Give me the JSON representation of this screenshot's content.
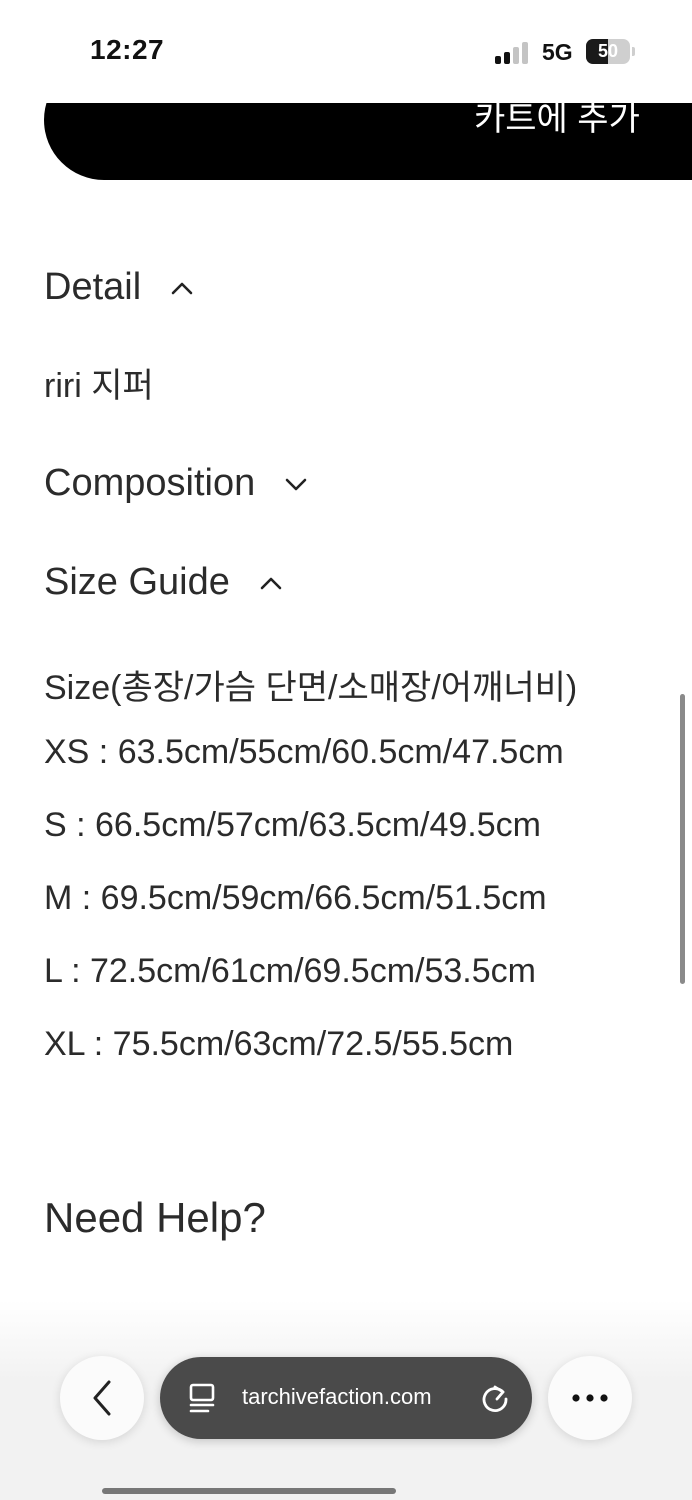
{
  "status_bar": {
    "time": "12:27",
    "network": "5G",
    "battery": "50",
    "battery_level": 0.5
  },
  "cart": {
    "label": "카트에 추가"
  },
  "sections": {
    "detail": {
      "title": "Detail",
      "expanded": true,
      "text": "riri 지퍼"
    },
    "composition": {
      "title": "Composition",
      "expanded": false
    },
    "size_guide": {
      "title": "Size Guide",
      "expanded": true,
      "header": "Size(총장/가슴 단면/소매장/어깨너비)",
      "rows": [
        "XS : 63.5cm/55cm/60.5cm/47.5cm",
        "S : 66.5cm/57cm/63.5cm/49.5cm",
        "M : 69.5cm/59cm/66.5cm/51.5cm",
        "L : 72.5cm/61cm/69.5cm/53.5cm",
        "XL : 75.5cm/63cm/72.5/55.5cm"
      ]
    }
  },
  "help": {
    "title": "Need Help?"
  },
  "browser": {
    "url": "tarchivefaction.com",
    "icons": {
      "back": "chevron-left-icon",
      "tabs": "page-icon",
      "reload": "reload-icon",
      "more": "more-icon"
    }
  },
  "colors": {
    "cart_button": "#000000",
    "text": "#2b2b2b",
    "url_pill": "#4a4a4a"
  }
}
